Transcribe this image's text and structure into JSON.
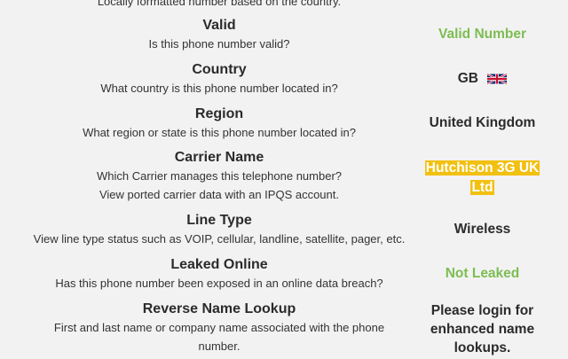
{
  "top_cut_text": "Locally formatted number based on the country.",
  "rows": [
    {
      "title": "Valid",
      "description": [
        "Is this phone number valid?"
      ],
      "value": "Valid Number",
      "value_color": "#7dbd52"
    },
    {
      "title": "Country",
      "description": [
        "What country is this phone number located in?"
      ],
      "value": "GB",
      "flag_icon": "uk-flag-icon"
    },
    {
      "title": "Region",
      "description": [
        "What region or state is this phone number located in?"
      ],
      "value": "United Kingdom"
    },
    {
      "title": "Carrier Name",
      "description": [
        "Which Carrier manages this telephone number?",
        "View ported carrier data with an IPQS account."
      ],
      "value_lines": [
        "Hutchison 3G UK",
        "Ltd"
      ],
      "value_highlight_color": "#f2c011"
    },
    {
      "title": "Line Type",
      "description": [
        "View line type status such as VOIP, cellular, landline, satellite, pager, etc."
      ],
      "value": "Wireless"
    },
    {
      "title": "Leaked Online",
      "description": [
        "Has this phone number been exposed in an online data breach?"
      ],
      "value": "Not Leaked",
      "value_color": "#7dbd52"
    },
    {
      "title": "Reverse Name Lookup",
      "description": [
        "First and last name or company name associated with the phone",
        "number."
      ],
      "value_lines": [
        "Please login for",
        "enhanced name",
        "lookups."
      ]
    }
  ]
}
